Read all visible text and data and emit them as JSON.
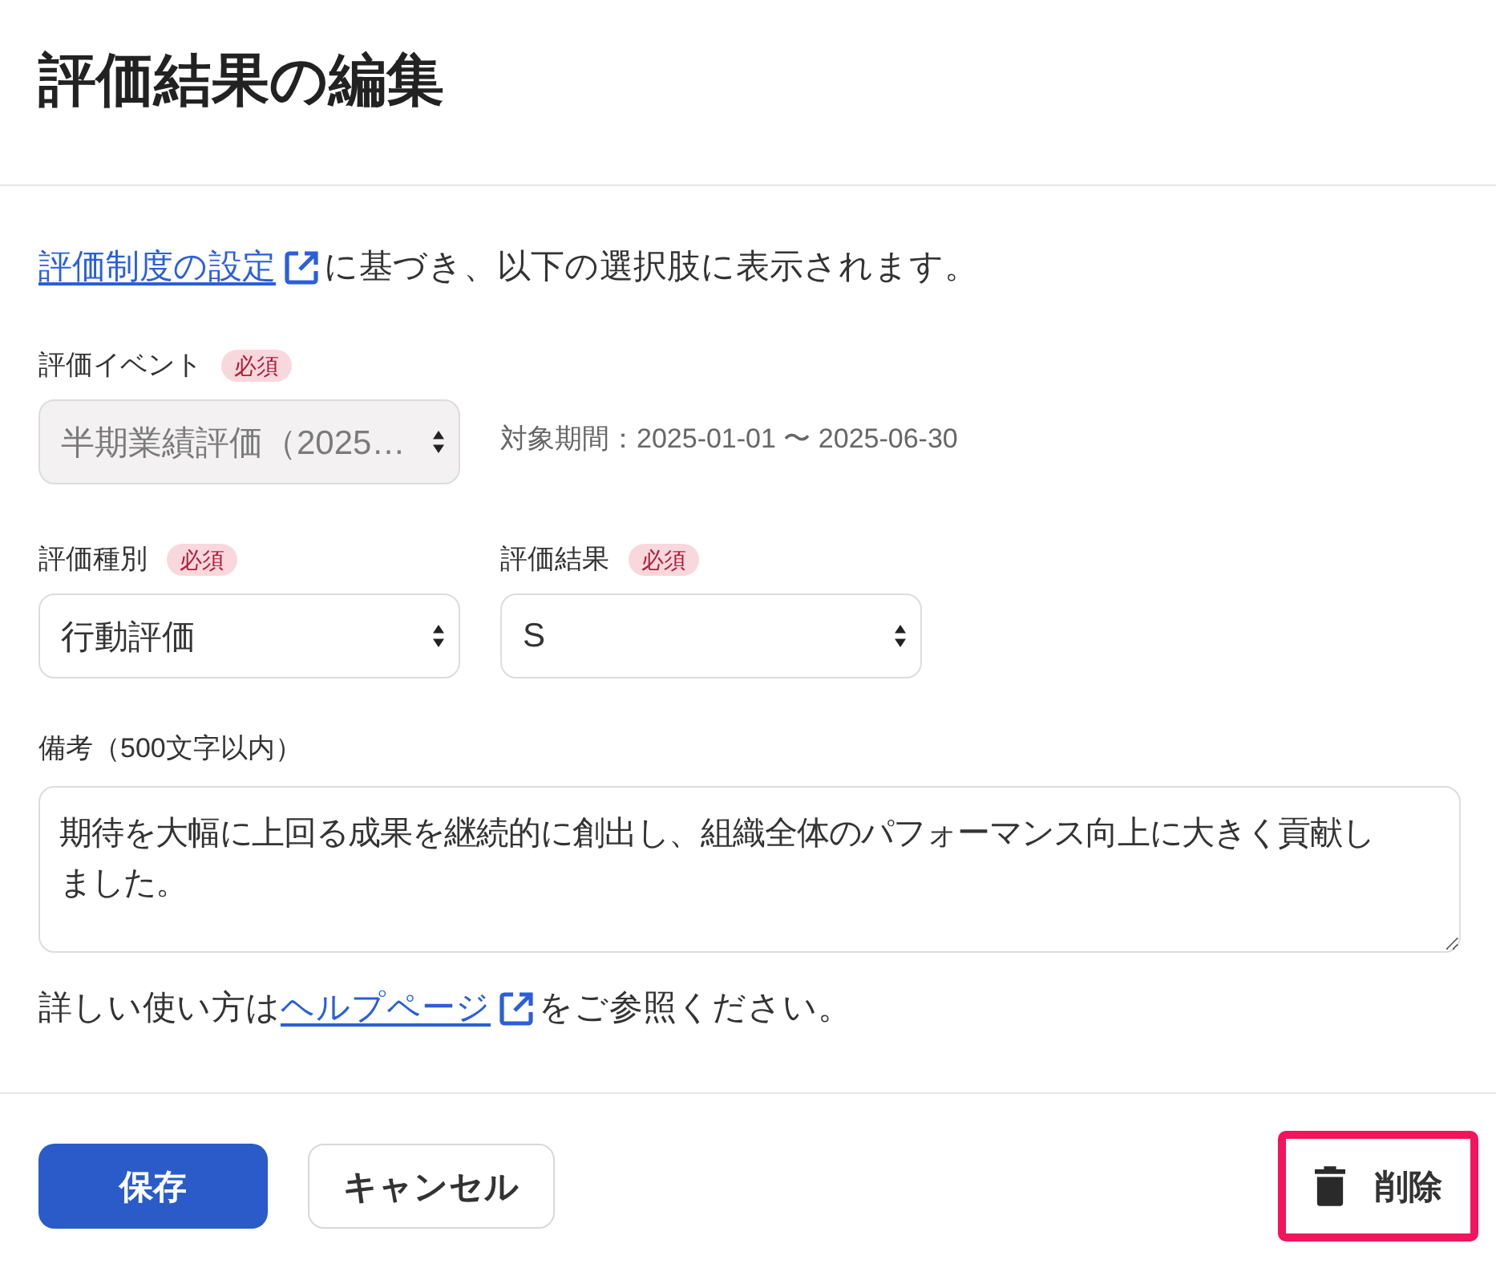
{
  "header": {
    "title": "評価結果の編集"
  },
  "intro": {
    "link": "評価制度の設定",
    "text": "に基づき、以下の選択肢に表示されます。"
  },
  "field_rows": [
    {
      "fields": [
        {
          "label": "評価イベント",
          "required": true,
          "badge": "必須",
          "value": "半期業績評価（2025…",
          "disabled": true
        }
      ],
      "note": "対象期間：2025-01-01 〜 2025-06-30"
    },
    {
      "fields": [
        {
          "label": "評価種別",
          "required": true,
          "badge": "必須",
          "value": "行動評価",
          "disabled": false
        },
        {
          "label": "評価結果",
          "required": true,
          "badge": "必須",
          "value": "S",
          "disabled": false
        }
      ]
    }
  ],
  "memo": {
    "label": "備考（500文字以内）",
    "value": "期待を大幅に上回る成果を継続的に創出し、組織全体のパフォーマンス向上に大きく貢献しました。"
  },
  "help": {
    "before": "詳しい使い方は",
    "link": "ヘルプページ",
    "after": "をご参照ください。"
  },
  "actions": [
    {
      "kind": "primary",
      "label": "保存",
      "highlighted": false
    },
    {
      "kind": "secondary",
      "label": "キャンセル",
      "highlighted": false
    },
    {
      "kind": "danger",
      "label": "削除",
      "highlighted": true
    }
  ]
}
